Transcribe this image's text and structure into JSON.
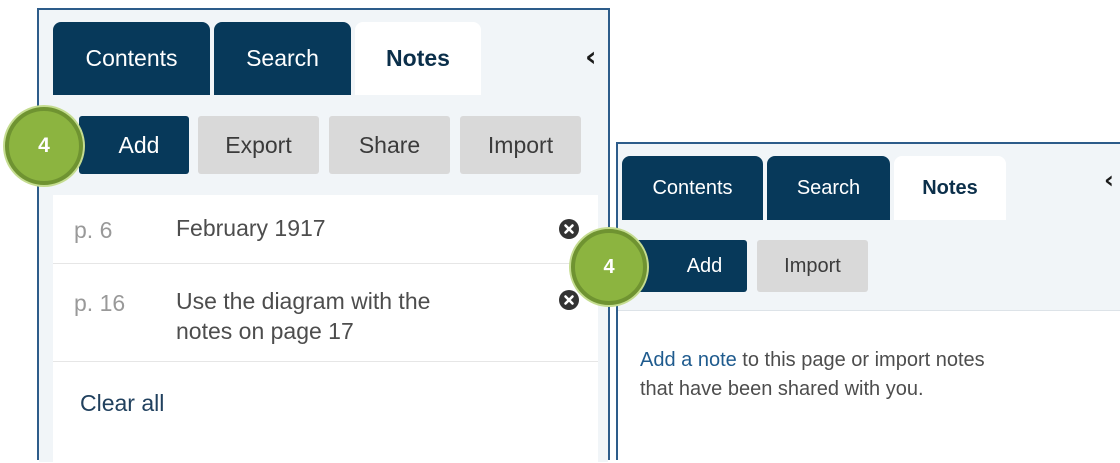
{
  "left_panel": {
    "tabs": [
      {
        "label": "Contents"
      },
      {
        "label": "Search"
      },
      {
        "label": "Notes"
      }
    ],
    "collapse_icon": "‹",
    "buttons": {
      "add": "Add",
      "export": "Export",
      "share": "Share",
      "import": "Import"
    },
    "badge": "4",
    "notes": [
      {
        "page": "p. 6",
        "text": "February 1917"
      },
      {
        "page": "p. 16",
        "text_line1": "Use the diagram with the",
        "text_line2": "notes on page 17"
      }
    ],
    "clear_all": "Clear all"
  },
  "right_panel": {
    "tabs": [
      {
        "label": "Contents"
      },
      {
        "label": "Search"
      },
      {
        "label": "Notes"
      }
    ],
    "collapse_icon": "‹",
    "buttons": {
      "add": "Add",
      "import": "Import"
    },
    "badge": "4",
    "message": {
      "link": "Add a note",
      "rest_line1": " to this page or import notes",
      "line2": "that have been shared with you."
    }
  },
  "icons": {
    "collapse": "chevron-left-icon",
    "delete": "close-circle-icon"
  },
  "colors": {
    "tab_dark": "#07395a",
    "badge_green": "#8cb440",
    "link_blue": "#1f5b8e"
  }
}
